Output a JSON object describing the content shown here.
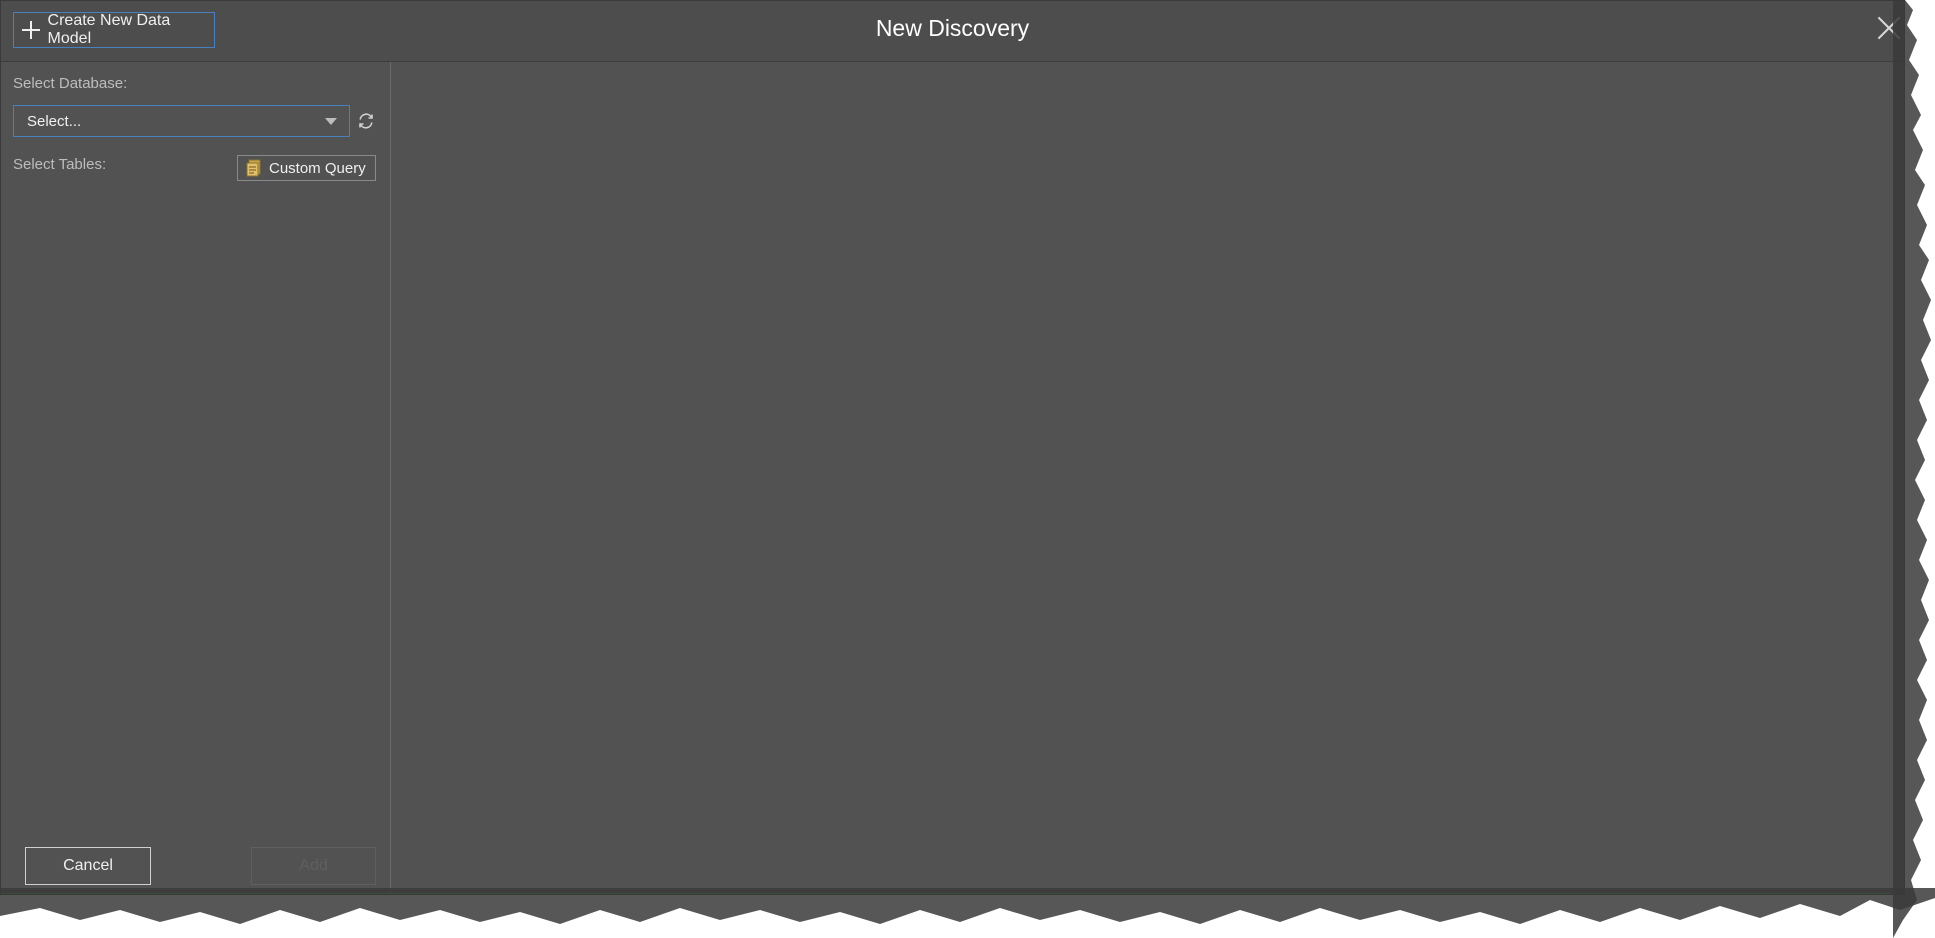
{
  "header": {
    "create_button_label": "Create New Data Model",
    "title": "New Discovery"
  },
  "left_panel": {
    "select_database_label": "Select Database:",
    "database_select_value": "Select...",
    "select_tables_label": "Select Tables:",
    "custom_query_label": "Custom Query"
  },
  "footer": {
    "cancel_label": "Cancel",
    "add_label": "Add"
  },
  "colors": {
    "dialog_bg": "#525252",
    "accent_border": "#4a7fc0",
    "status_strip": "#2fbf2f"
  },
  "icons": [
    "plus-icon",
    "close-icon",
    "chevron-down-icon",
    "refresh-icon",
    "query-icon"
  ]
}
